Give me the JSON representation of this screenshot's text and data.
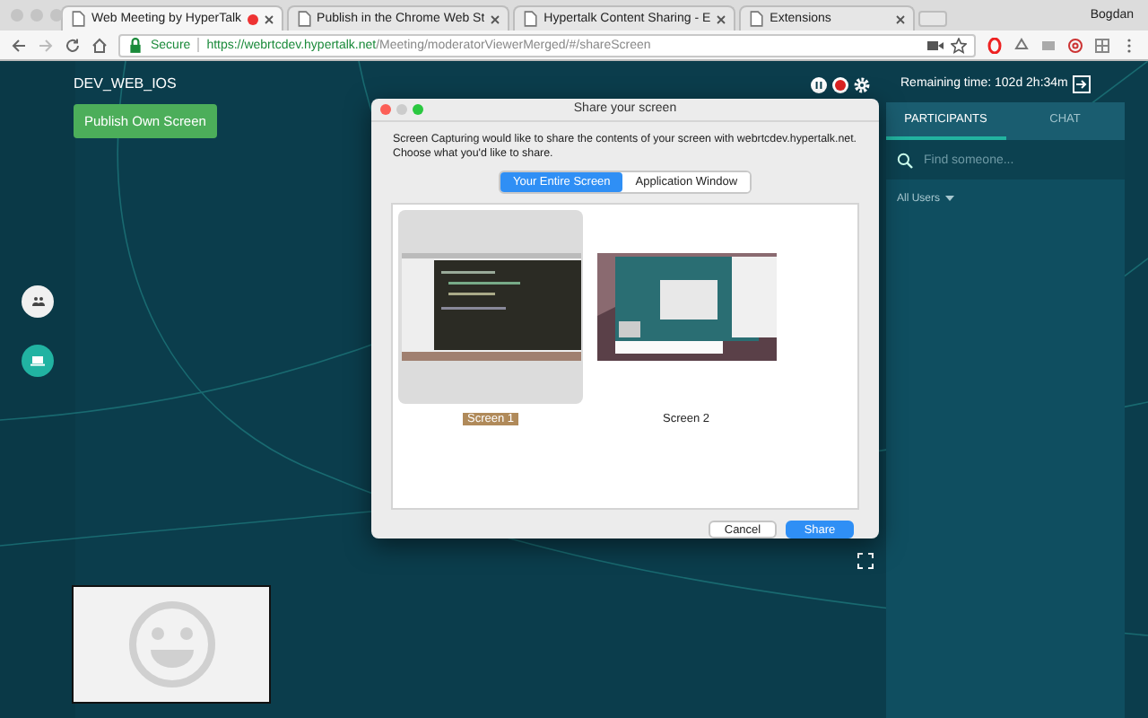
{
  "browser": {
    "tabs": [
      {
        "title": "Web Meeting by HyperTalk",
        "selected": true,
        "recording": true
      },
      {
        "title": "Publish in the Chrome Web St",
        "selected": false,
        "recording": false
      },
      {
        "title": "Hypertalk Content Sharing - E",
        "selected": false,
        "recording": false
      },
      {
        "title": "Extensions",
        "selected": false,
        "recording": false
      }
    ],
    "profile": "Bogdan",
    "address": {
      "secure_label": "Secure",
      "host": "https://webrtcdev.hypertalk.net",
      "path": "/Meeting/moderatorViewerMerged/#/shareScreen"
    }
  },
  "app": {
    "room_name": "DEV_WEB_IOS",
    "publish_button": "Publish Own Screen",
    "remaining_time": "Remaining time: 102d 2h:34m",
    "panel": {
      "tabs": [
        {
          "label": "PARTICIPANTS",
          "selected": true
        },
        {
          "label": "CHAT",
          "selected": false
        }
      ],
      "search": {
        "placeholder": "Find someone..."
      },
      "filter": "All Users"
    }
  },
  "dialog": {
    "title": "Share your screen",
    "message": "Screen Capturing would like to share the contents of your screen with webrtcdev.hypertalk.net. Choose what you'd like to share.",
    "segments": [
      {
        "label": "Your Entire Screen",
        "selected": true
      },
      {
        "label": "Application Window",
        "selected": false
      }
    ],
    "screens": [
      {
        "label": "Screen 1",
        "selected": true,
        "kind": "editor"
      },
      {
        "label": "Screen 2",
        "selected": false,
        "kind": "desktop"
      }
    ],
    "buttons": [
      {
        "label": "Cancel",
        "kind": "secondary"
      },
      {
        "label": "Share",
        "kind": "primary"
      }
    ]
  }
}
